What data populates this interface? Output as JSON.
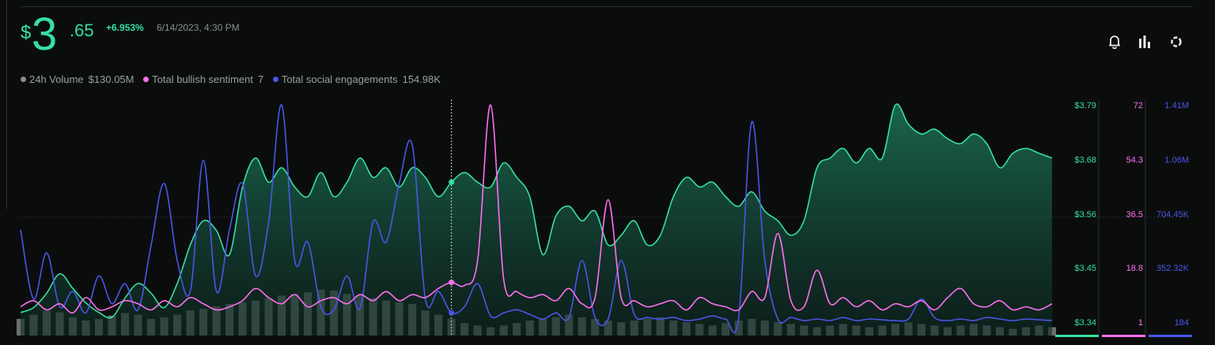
{
  "header": {
    "price_currency": "$",
    "price_int": "3",
    "price_dec": ".65",
    "change": "+6.953%",
    "timestamp": "6/14/2023, 4:30 PM"
  },
  "legend": [
    {
      "label": "24h Volume",
      "value": "$130.05M",
      "color": "#8d8d8d"
    },
    {
      "label": "Total bullish sentiment",
      "value": "7",
      "color": "#ff6ef0"
    },
    {
      "label": "Total social engagements",
      "value": "154.98K",
      "color": "#4a56e8"
    }
  ],
  "toolbar": {
    "icons": [
      "bell-icon",
      "bar-chart-icon",
      "settings-gear-icon"
    ]
  },
  "chart_data": {
    "type": "area",
    "x_count": 80,
    "axes": {
      "price": {
        "ticks": [
          "$3.79",
          "$3.68",
          "$3.56",
          "$3.45",
          "$3.34"
        ],
        "ylim": [
          3.34,
          3.79
        ],
        "color": "#35e0a0"
      },
      "sentiment": {
        "ticks": [
          "72",
          "54.3",
          "36.5",
          "18.8",
          "1"
        ],
        "ylim": [
          1,
          72
        ],
        "color": "#ff6ef0"
      },
      "engagements": {
        "ticks": [
          "1.41M",
          "1.06M",
          "704.45K",
          "352.32K",
          "184"
        ],
        "ylim": [
          184,
          1410000
        ],
        "color": "#4a56e8"
      }
    },
    "series": [
      {
        "name": "Price",
        "axis": "price",
        "color": "#35e0a0",
        "values": [
          3.36,
          3.37,
          3.4,
          3.44,
          3.41,
          3.38,
          3.36,
          3.35,
          3.39,
          3.42,
          3.4,
          3.37,
          3.42,
          3.5,
          3.55,
          3.53,
          3.48,
          3.62,
          3.68,
          3.63,
          3.66,
          3.62,
          3.6,
          3.65,
          3.6,
          3.63,
          3.68,
          3.64,
          3.66,
          3.62,
          3.66,
          3.64,
          3.6,
          3.63,
          3.65,
          3.63,
          3.62,
          3.67,
          3.64,
          3.6,
          3.48,
          3.56,
          3.58,
          3.55,
          3.57,
          3.5,
          3.52,
          3.55,
          3.5,
          3.52,
          3.6,
          3.64,
          3.62,
          3.63,
          3.6,
          3.58,
          3.61,
          3.57,
          3.55,
          3.52,
          3.55,
          3.66,
          3.68,
          3.7,
          3.67,
          3.7,
          3.68,
          3.79,
          3.75,
          3.73,
          3.74,
          3.72,
          3.71,
          3.73,
          3.71,
          3.66,
          3.69,
          3.7,
          3.69,
          3.68
        ]
      },
      {
        "name": "Total bullish sentiment",
        "axis": "sentiment",
        "color": "#ff6ef0",
        "values": [
          6,
          8,
          5,
          7,
          4,
          9,
          5,
          6,
          8,
          7,
          5,
          8,
          6,
          9,
          7,
          5,
          6,
          8,
          12,
          9,
          7,
          10,
          6,
          8,
          9,
          7,
          10,
          8,
          11,
          8,
          10,
          9,
          12,
          14,
          13,
          21,
          72,
          15,
          11,
          9,
          10,
          8,
          12,
          7,
          9,
          41,
          9,
          8,
          6,
          7,
          8,
          5,
          9,
          7,
          6,
          5,
          11,
          9,
          30,
          8,
          6,
          18,
          7,
          9,
          6,
          8,
          5,
          7,
          6,
          8,
          5,
          9,
          12,
          7,
          6,
          8,
          5,
          6,
          5,
          7
        ]
      },
      {
        "name": "Total social engagements",
        "axis": "engagements",
        "color": "#4a56e8",
        "values": [
          600000,
          150000,
          450000,
          100000,
          200000,
          60000,
          300000,
          120000,
          250000,
          80000,
          500000,
          900000,
          400000,
          200000,
          1050000,
          200000,
          600000,
          900000,
          300000,
          650000,
          1410000,
          400000,
          520000,
          100000,
          80000,
          300000,
          90000,
          650000,
          520000,
          900000,
          1150000,
          150000,
          200000,
          60000,
          100000,
          250000,
          40000,
          60000,
          80000,
          50000,
          20000,
          60000,
          30000,
          400000,
          30000,
          20000,
          400000,
          50000,
          30000,
          20000,
          30000,
          10000,
          20000,
          40000,
          20000,
          30000,
          1300000,
          400000,
          20000,
          30000,
          10000,
          20000,
          10000,
          30000,
          10000,
          20000,
          15000,
          10000,
          20000,
          150000,
          30000,
          10000,
          20000,
          10000,
          30000,
          20000,
          10000,
          20000,
          15000,
          10000
        ]
      },
      {
        "name": "24h Volume",
        "axis": "volume",
        "color": "#8d8d8d",
        "values": [
          20,
          25,
          30,
          28,
          22,
          18,
          20,
          24,
          27,
          25,
          20,
          22,
          25,
          30,
          32,
          35,
          38,
          40,
          42,
          45,
          48,
          50,
          52,
          55,
          54,
          50,
          48,
          45,
          42,
          40,
          38,
          30,
          25,
          20,
          15,
          12,
          10,
          12,
          15,
          18,
          20,
          22,
          25,
          22,
          20,
          18,
          16,
          18,
          20,
          22,
          18,
          16,
          14,
          12,
          15,
          18,
          20,
          18,
          16,
          14,
          12,
          10,
          12,
          14,
          12,
          10,
          12,
          14,
          16,
          14,
          12,
          10,
          12,
          14,
          12,
          10,
          8,
          10,
          12,
          10
        ]
      }
    ],
    "crosshair_index": 33
  }
}
